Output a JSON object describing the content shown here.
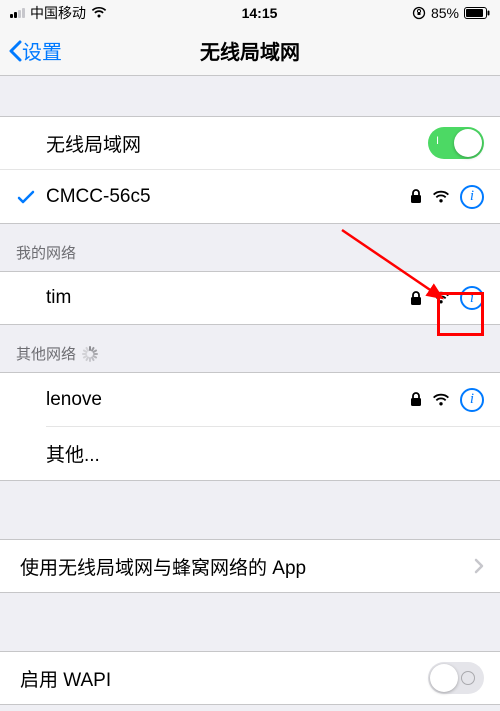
{
  "status": {
    "carrier": "中国移动",
    "time": "14:15",
    "battery": "85%"
  },
  "nav": {
    "back": "设置",
    "title": "无线局域网"
  },
  "wifi_toggle_label": "无线局域网",
  "connected_network": "CMCC-56c5",
  "sections": {
    "my_networks": "我的网络",
    "other_networks": "其他网络"
  },
  "networks": {
    "my": [
      "tim"
    ],
    "other": [
      "lenove"
    ],
    "other_join": "其他..."
  },
  "apps_row": "使用无线局域网与蜂窝网络的 App",
  "wapi_label": "启用 WAPI"
}
